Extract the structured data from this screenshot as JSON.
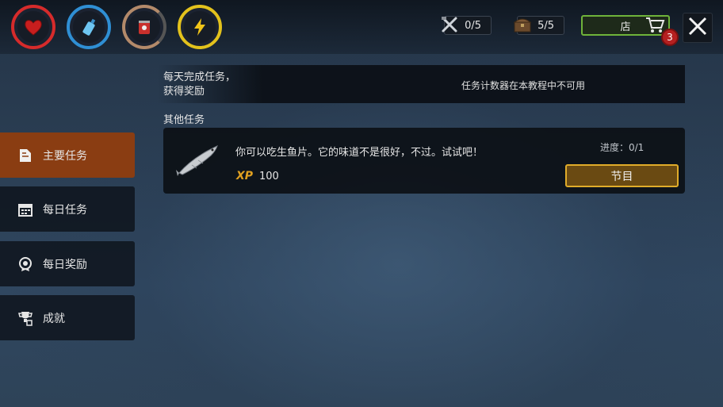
{
  "top_bar": {
    "stats": [
      {
        "name": "health",
        "icon": "heart-icon",
        "color": "#d62b2b"
      },
      {
        "name": "water",
        "icon": "water-bottle-icon",
        "color": "#2f8fd4"
      },
      {
        "name": "food",
        "icon": "food-can-icon",
        "color": "#b38a6a"
      },
      {
        "name": "energy",
        "icon": "lightning-icon",
        "color": "#e3c21c"
      }
    ],
    "tools_counter": "0/5",
    "chest_counter": "5/5",
    "shop_label": "店",
    "cart_badge": "3"
  },
  "sidebar": {
    "items": [
      {
        "label": "主要任务",
        "icon": "main-quest-icon",
        "active": true
      },
      {
        "label": "每日任务",
        "icon": "calendar-icon",
        "active": false
      },
      {
        "label": "每日奖励",
        "icon": "medal-icon",
        "active": false
      },
      {
        "label": "成就",
        "icon": "trophy-icon",
        "active": false
      }
    ]
  },
  "daily": {
    "title": "每天完成任务，\n获得奖励",
    "note": "任务计数器在本教程中不可用"
  },
  "other_tasks": {
    "section_label": "其他任务",
    "task": {
      "icon": "fish-icon",
      "description": "你可以吃生鱼片。它的味道不是很好，不过。试试吧！",
      "xp_label": "XP",
      "xp_value": "100",
      "progress": "进度：0/1",
      "button_label": "节目"
    }
  },
  "colors": {
    "active_tab": "#8a3d12",
    "button_border": "#e0ac2a",
    "shop_border": "#6fb33a",
    "badge": "#b52020"
  }
}
